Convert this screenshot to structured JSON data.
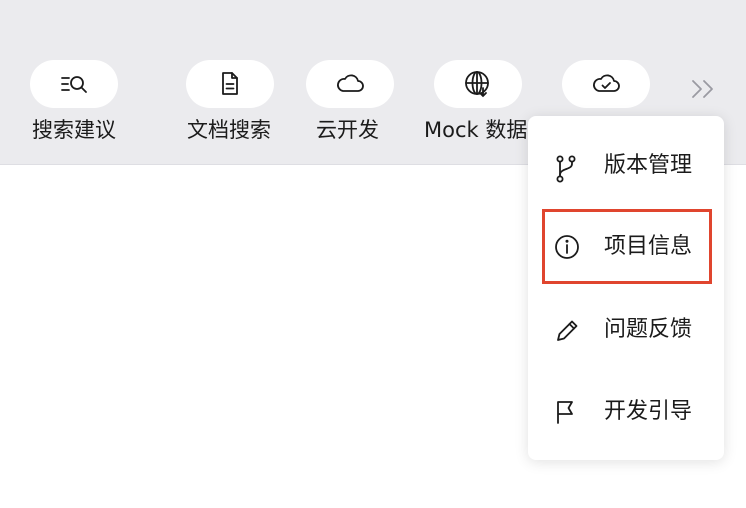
{
  "toolbar": {
    "tools": [
      {
        "label": "搜索建议",
        "icon": "search-list-icon"
      },
      {
        "label": "文档搜索",
        "icon": "document-icon"
      },
      {
        "label": "云开发",
        "icon": "cloud-icon"
      },
      {
        "label": "Mock 数据",
        "icon": "globe-download-icon"
      },
      {
        "label": "",
        "icon": "cloud-check-icon"
      }
    ],
    "overflow_icon": "double-chevron-right-icon"
  },
  "dropdown": {
    "items": [
      {
        "label": "版本管理",
        "icon": "branch-icon"
      },
      {
        "label": "项目信息",
        "icon": "info-icon"
      },
      {
        "label": "问题反馈",
        "icon": "pencil-icon"
      },
      {
        "label": "开发引导",
        "icon": "flag-icon"
      }
    ],
    "highlighted_index": 1,
    "highlight_color": "#e0452e"
  }
}
